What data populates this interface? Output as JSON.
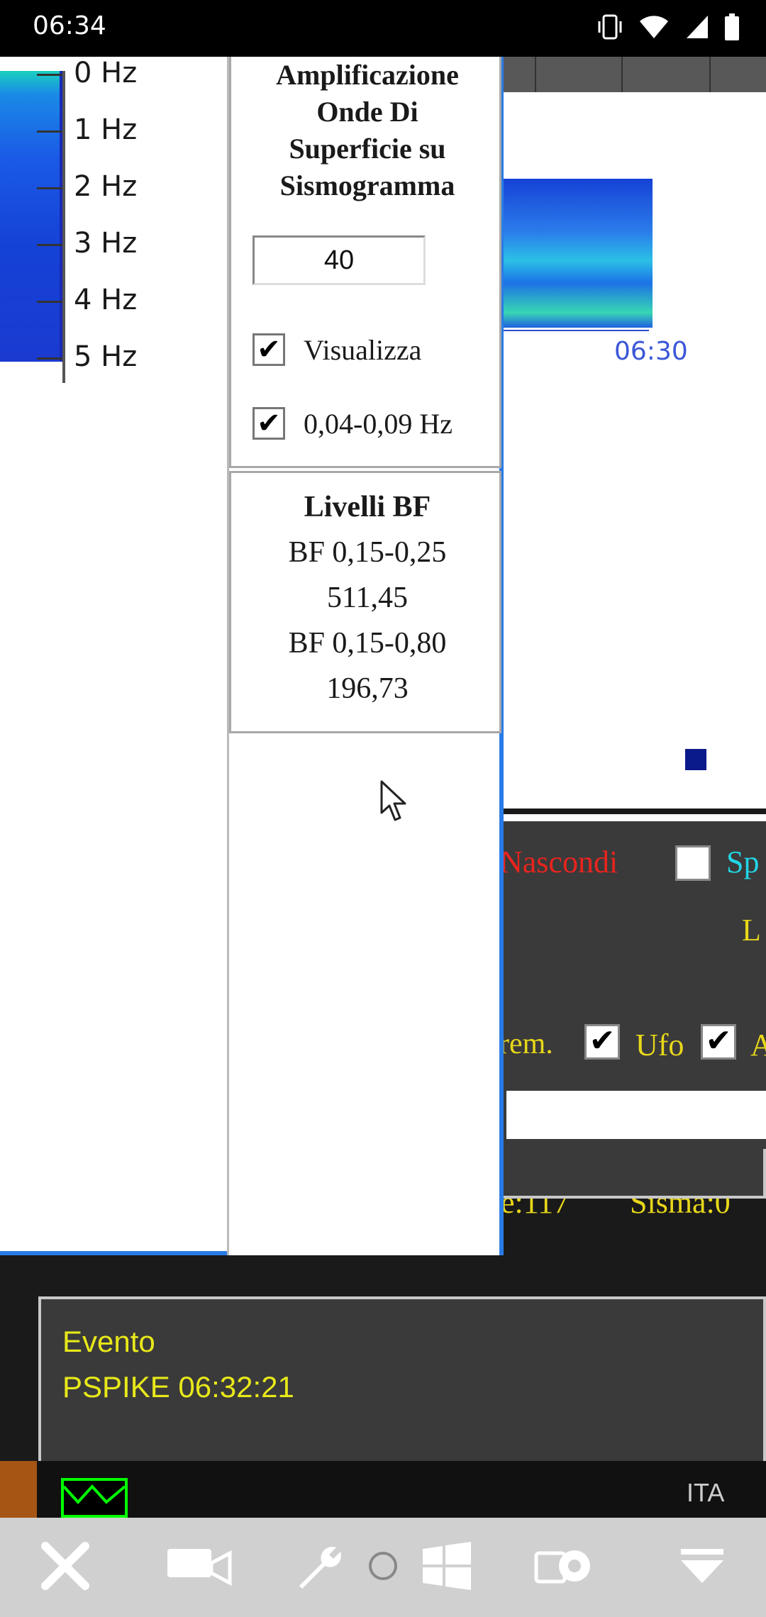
{
  "statusbar": {
    "time": "06:34"
  },
  "spectrogram": {
    "hz_labels": [
      "0 Hz",
      "1 Hz",
      "2 Hz",
      "3 Hz",
      "4 Hz",
      "5 Hz"
    ]
  },
  "popup": {
    "title_lines": [
      "Amplificazione",
      "Onde Di",
      "Superficie su",
      "Sismogramma"
    ],
    "amplification_value": "40",
    "visualizza_label": "Visualizza",
    "visualizza_checked": true,
    "freq_label": "0,04-0,09 Hz",
    "freq_checked": true,
    "livelli": {
      "title": "Livelli BF",
      "bf1_label": "BF 0,15-0,25",
      "bf1_value": "511,45",
      "bf2_label": "BF 0,15-0,80",
      "bf2_value": "196,73"
    }
  },
  "seismo": {
    "time_label": "06:30",
    "nascondi": "Nascondi",
    "sp_label": "Sp",
    "l_label": "L",
    "rem_label": "rem.",
    "ufo_label": "Ufo",
    "a_label": "A",
    "count_label": "e:117",
    "sisma_label": "Sisma:0"
  },
  "evento": {
    "line1": "Evento",
    "line2": "PSPIKE 06:32:21"
  },
  "taskbar": {
    "lang": "ITA"
  },
  "colors": {
    "accent_blue": "#2a7be6",
    "panel_dark": "#3a3a3a",
    "text_yellow": "#e8e81a",
    "text_red": "#e8241e",
    "text_cyan": "#22d5e6"
  }
}
